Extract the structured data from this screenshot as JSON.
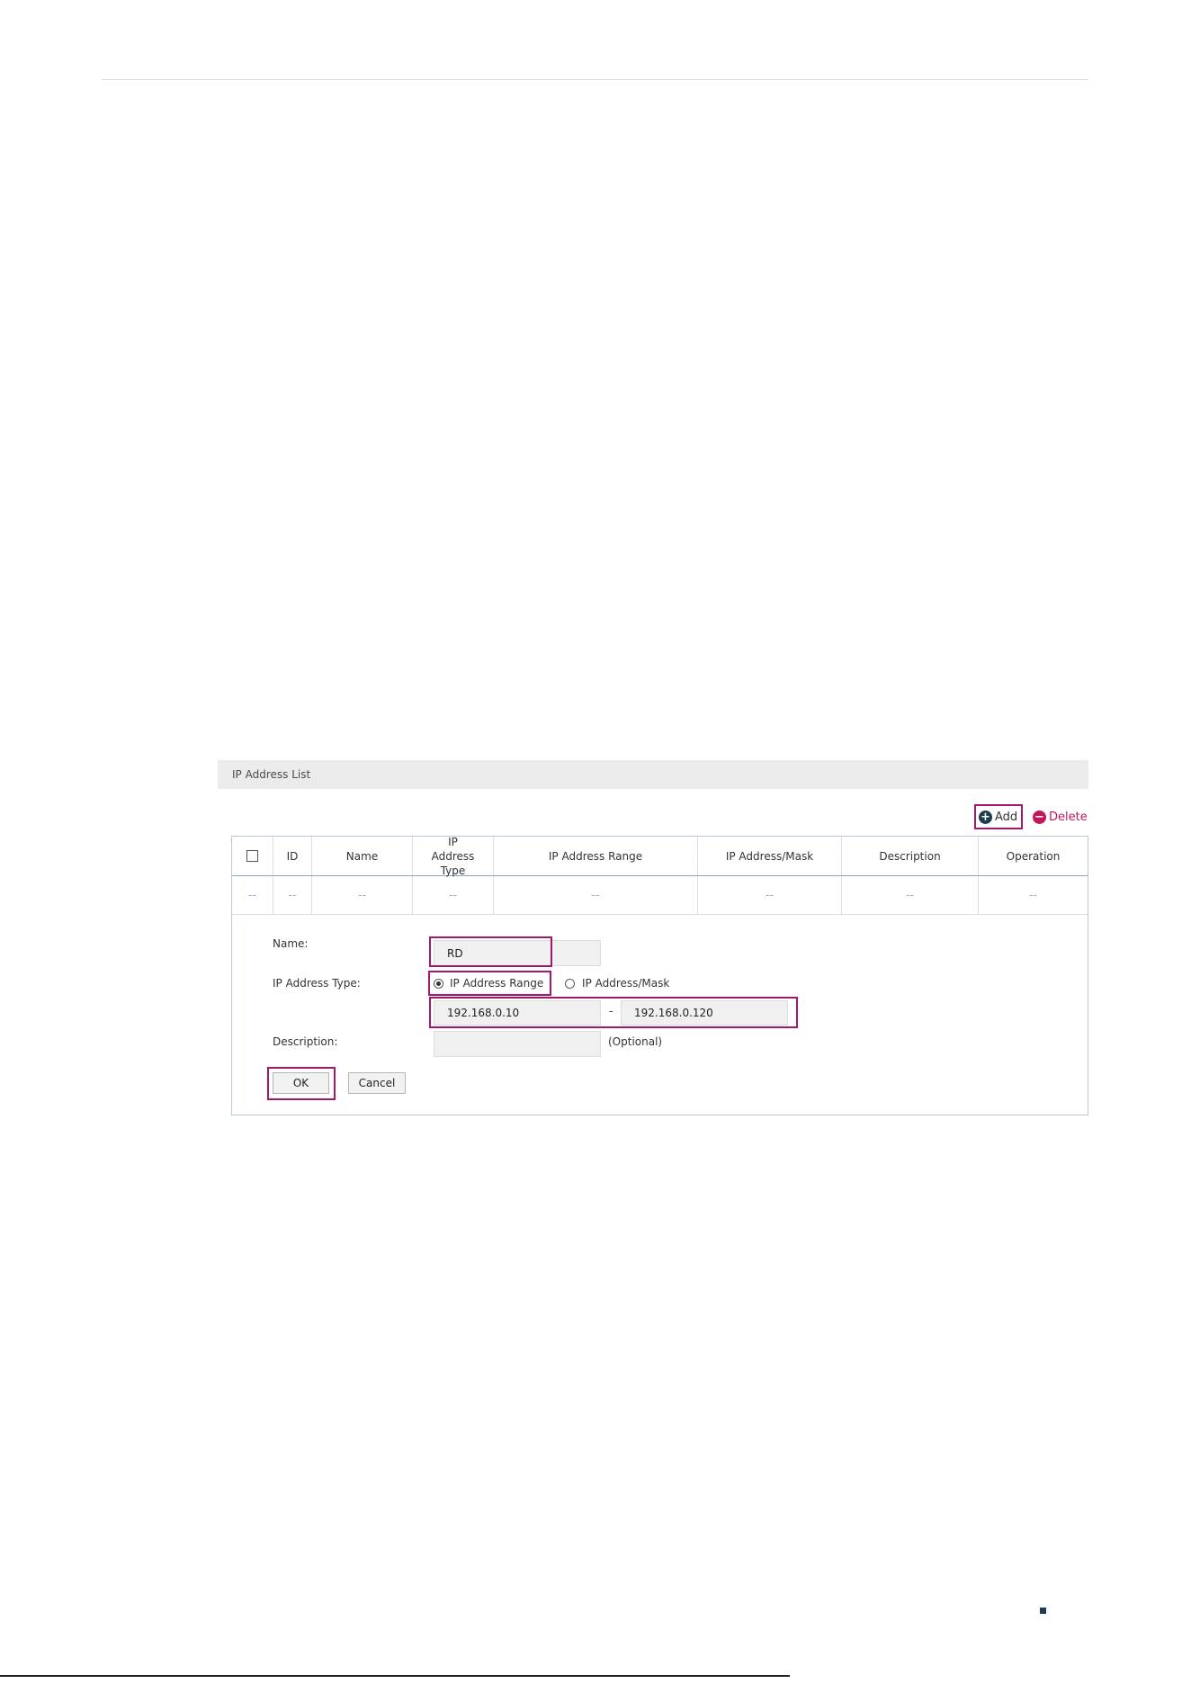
{
  "panel": {
    "title": "IP Address List"
  },
  "toolbar": {
    "add_label": "Add",
    "delete_label": "Delete"
  },
  "table": {
    "headers": [
      "ID",
      "Name",
      "IP Address Type",
      "IP Address Range",
      "IP Address/Mask",
      "Description",
      "Operation"
    ],
    "empty_cell": "--"
  },
  "form": {
    "name_label": "Name:",
    "name_value": "RD",
    "type_label": "IP Address Type:",
    "type_options": [
      "IP Address Range",
      "IP Address/Mask"
    ],
    "type_selected": "IP Address Range",
    "range_start": "192.168.0.10",
    "range_separator": "-",
    "range_end": "192.168.0.120",
    "description_label": "Description:",
    "description_value": "",
    "optional_hint": "(Optional)",
    "ok_label": "OK",
    "cancel_label": "Cancel"
  },
  "colors": {
    "highlight": "#a2186c",
    "delete": "#c2185b",
    "add_icon": "#1f3d50",
    "header_bg": "#ebebeb"
  }
}
